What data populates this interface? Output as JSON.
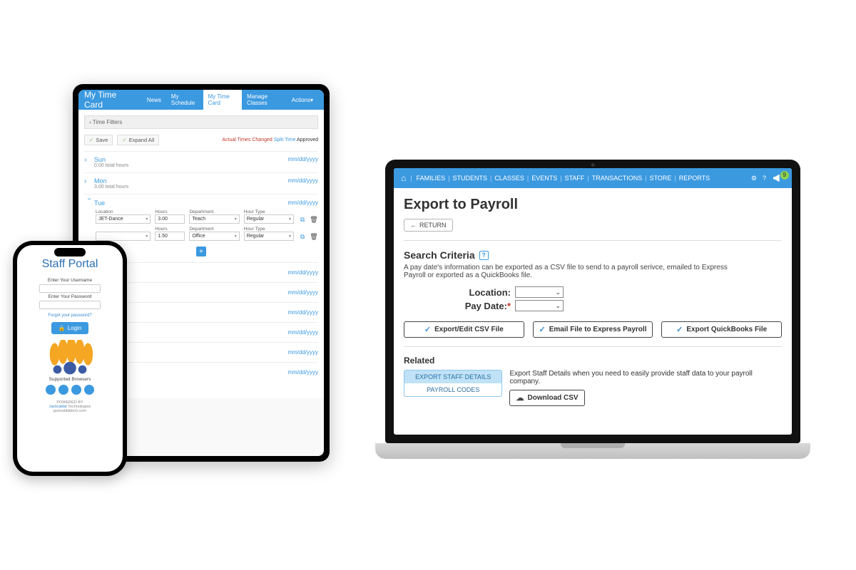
{
  "phone": {
    "title": "Staff Portal",
    "username_label": "Enter Your Username",
    "password_label": "Enter Your Password",
    "forgot": "Forgot your password?",
    "login": "Login",
    "supported": "Supported Browsers",
    "powered1": "POWERED BY",
    "powered2": "Jackrabbit",
    "powered2b": " Technologies",
    "powered3": "jackrabbittech.com"
  },
  "tablet": {
    "title": "My Time Card",
    "tabs": [
      "News",
      "My Schedule",
      "My Time Card",
      "Manage Classes",
      "Actions"
    ],
    "time_filters": "Time Filters",
    "save": "Save",
    "expand": "Expand All",
    "legend_actual": "Actual Times Changed",
    "legend_split": "Split Time",
    "legend_approved": " Approved",
    "date_ph": "mm/dd/yyyy",
    "days": [
      {
        "name": "Sun",
        "sub": "0.00 total hours"
      },
      {
        "name": "Mon",
        "sub": "3.00 total hours"
      },
      {
        "name": "Tue",
        "sub": ""
      }
    ],
    "fields": {
      "location": "Location",
      "hours": "Hours",
      "dept": "Department",
      "htype": "Hour Type"
    },
    "entries": [
      {
        "loc": "JET-Dance",
        "hours": "3.00",
        "dept": "Teach",
        "htype": "Regular"
      },
      {
        "loc": "",
        "hours": "1.50",
        "dept": "Office",
        "htype": "Regular"
      }
    ],
    "blank_hours": "hours",
    "add_total": "Hours"
  },
  "laptop": {
    "nav": [
      "FAMILIES",
      "STUDENTS",
      "CLASSES",
      "EVENTS",
      "STAFF",
      "TRANSACTIONS",
      "STORE",
      "REPORTS"
    ],
    "badge": "9",
    "h1": "Export to Payroll",
    "return": "RETURN",
    "h2": "Search Criteria",
    "desc": "A pay date's information can be exported as a CSV file to send to a payroll serivce, emailed to Express Payroll or exported as a QuickBooks file.",
    "loc_label": "Location:",
    "pay_label": "Pay Date:",
    "btn1": "Export/Edit CSV File",
    "btn2": "Email File to Express Payroll",
    "btn3": "Export QuickBooks File",
    "related": "Related",
    "rel1": "EXPORT STAFF DETAILS",
    "rel2": "PAYROLL CODES",
    "rel_desc": "Export Staff Details when you need to easily provide staff data to your payroll company.",
    "download": "Download CSV"
  }
}
